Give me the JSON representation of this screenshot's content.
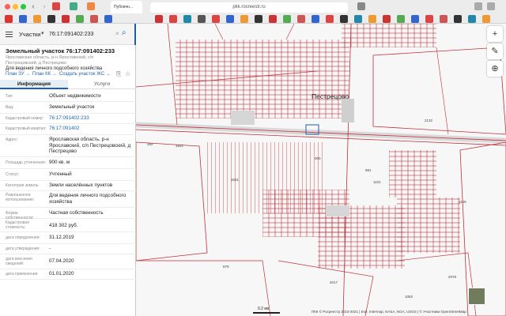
{
  "browser": {
    "active_tab_title": "Публичн...",
    "url": "pkk.rosreestr.ru"
  },
  "search": {
    "type_label": "Участки",
    "value": "76:17:091402:233"
  },
  "parcel": {
    "title": "Земельный участок 76:17:091402:233",
    "address_short": "Ярославская область, р-н Ярославский, с/п Пестрецовский, д Пестрецово",
    "purpose": "Для ведения личного подсобного хозяйства",
    "links": [
      "План ЗУ",
      "План КК",
      "Создать участок ЖС"
    ]
  },
  "tabs": [
    "Информация",
    "Услуги"
  ],
  "info_rows": [
    {
      "label": "Тип:",
      "value": "Объект недвижимости"
    },
    {
      "label": "Вид:",
      "value": "Земельный участок"
    },
    {
      "label": "Кадастровый номер:",
      "value": "76:17:091402:233"
    },
    {
      "label": "Кадастровый квартал:",
      "value": "76:17:091402"
    },
    {
      "label": "Адрес:",
      "value": "Ярославская область, р-н Ярославский, с/п Пестрецовский, д Пестрецово"
    },
    {
      "label": "Площадь уточненная:",
      "value": "900 кв. м"
    },
    {
      "label": "Статус:",
      "value": "Учтенный"
    },
    {
      "label": "Категория земель:",
      "value": "Земли населённых пунктов"
    },
    {
      "label": "Разрешенное использование:",
      "value": "Для ведения личного подсобного хозяйства"
    },
    {
      "label": "Форма собственности:",
      "value": "Частная собственность"
    },
    {
      "label": "Кадастровая стоимость:",
      "value": "418 302 руб."
    },
    {
      "label": "дата определения:",
      "value": "31.12.2019"
    },
    {
      "label": "дата утверждения:",
      "value": "-"
    },
    {
      "label": "дата внесения сведений:",
      "value": "07.04.2020"
    },
    {
      "label": "дата применения:",
      "value": "01.01.2020"
    }
  ],
  "map": {
    "place_name": "Пестрецово",
    "parcel_labels": [
      "2132",
      "392",
      "1621",
      "1621",
      "900",
      "881",
      "879",
      "1101",
      "4017",
      "2078",
      "1063",
      "1129"
    ],
    "scale": "0.2 км",
    "attribution": "ПКК © Росреестр 2010-2021 | Esri, Intermap, NASA, NGA, USGS | © Участники OpenStreetMap",
    "controls": [
      "+",
      "−",
      "✎",
      "⊕"
    ]
  },
  "colors": {
    "accent": "#1a5fb4",
    "parcel_line": "#c0303a",
    "link": "#1a63b5"
  }
}
